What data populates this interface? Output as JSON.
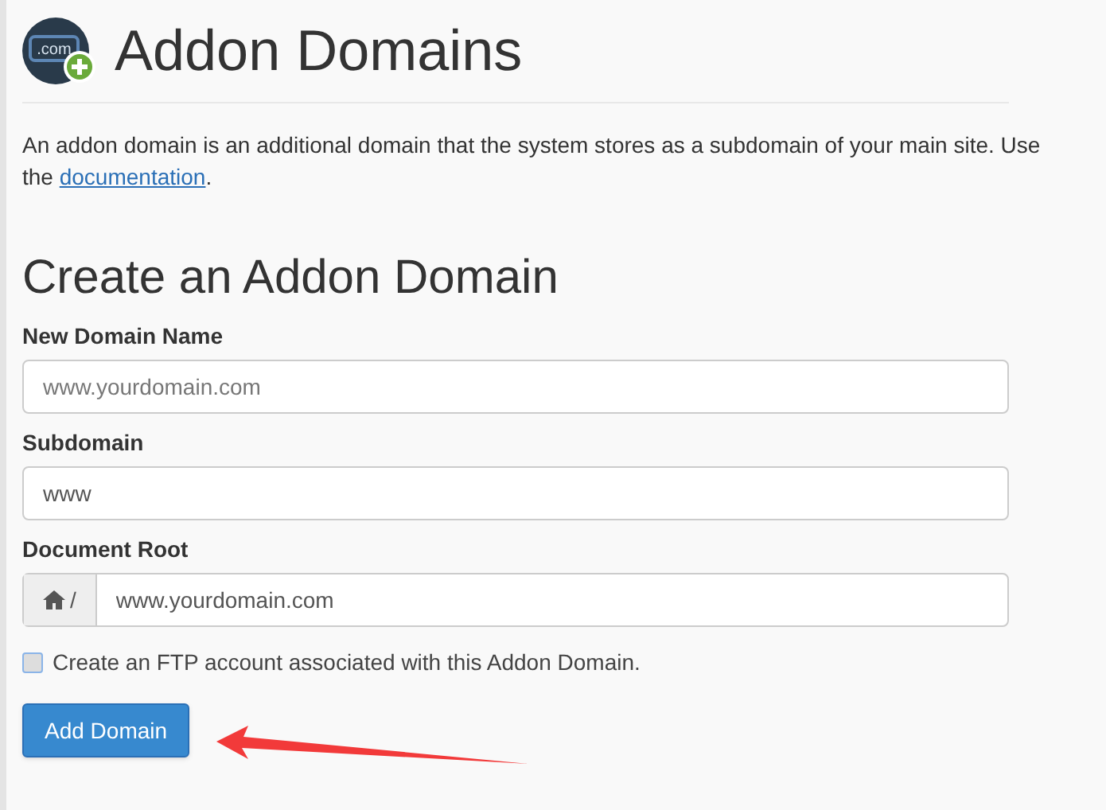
{
  "header": {
    "title": "Addon Domains",
    "icon_text": ".com"
  },
  "description": {
    "line_1": "An addon domain is an additional domain that the system stores as a subdomain of your main site. Use",
    "line_2_start": "the",
    "link": "documentation",
    "line_2_end": "."
  },
  "form": {
    "title": "Create an Addon Domain",
    "fields": [
      {
        "kind": "text",
        "label": "New Domain Name",
        "placeholder": "www.yourdomain.com"
      },
      {
        "kind": "text",
        "label": "Subdomain",
        "value": "www"
      },
      {
        "kind": "path",
        "label": "Document Root",
        "prefix": "/",
        "value": "www.yourdomain.com"
      }
    ],
    "ftp_checkbox": {
      "label": "Create an FTP account associated with this Addon Domain.",
      "checked": false
    },
    "submit": "Add Domain"
  }
}
